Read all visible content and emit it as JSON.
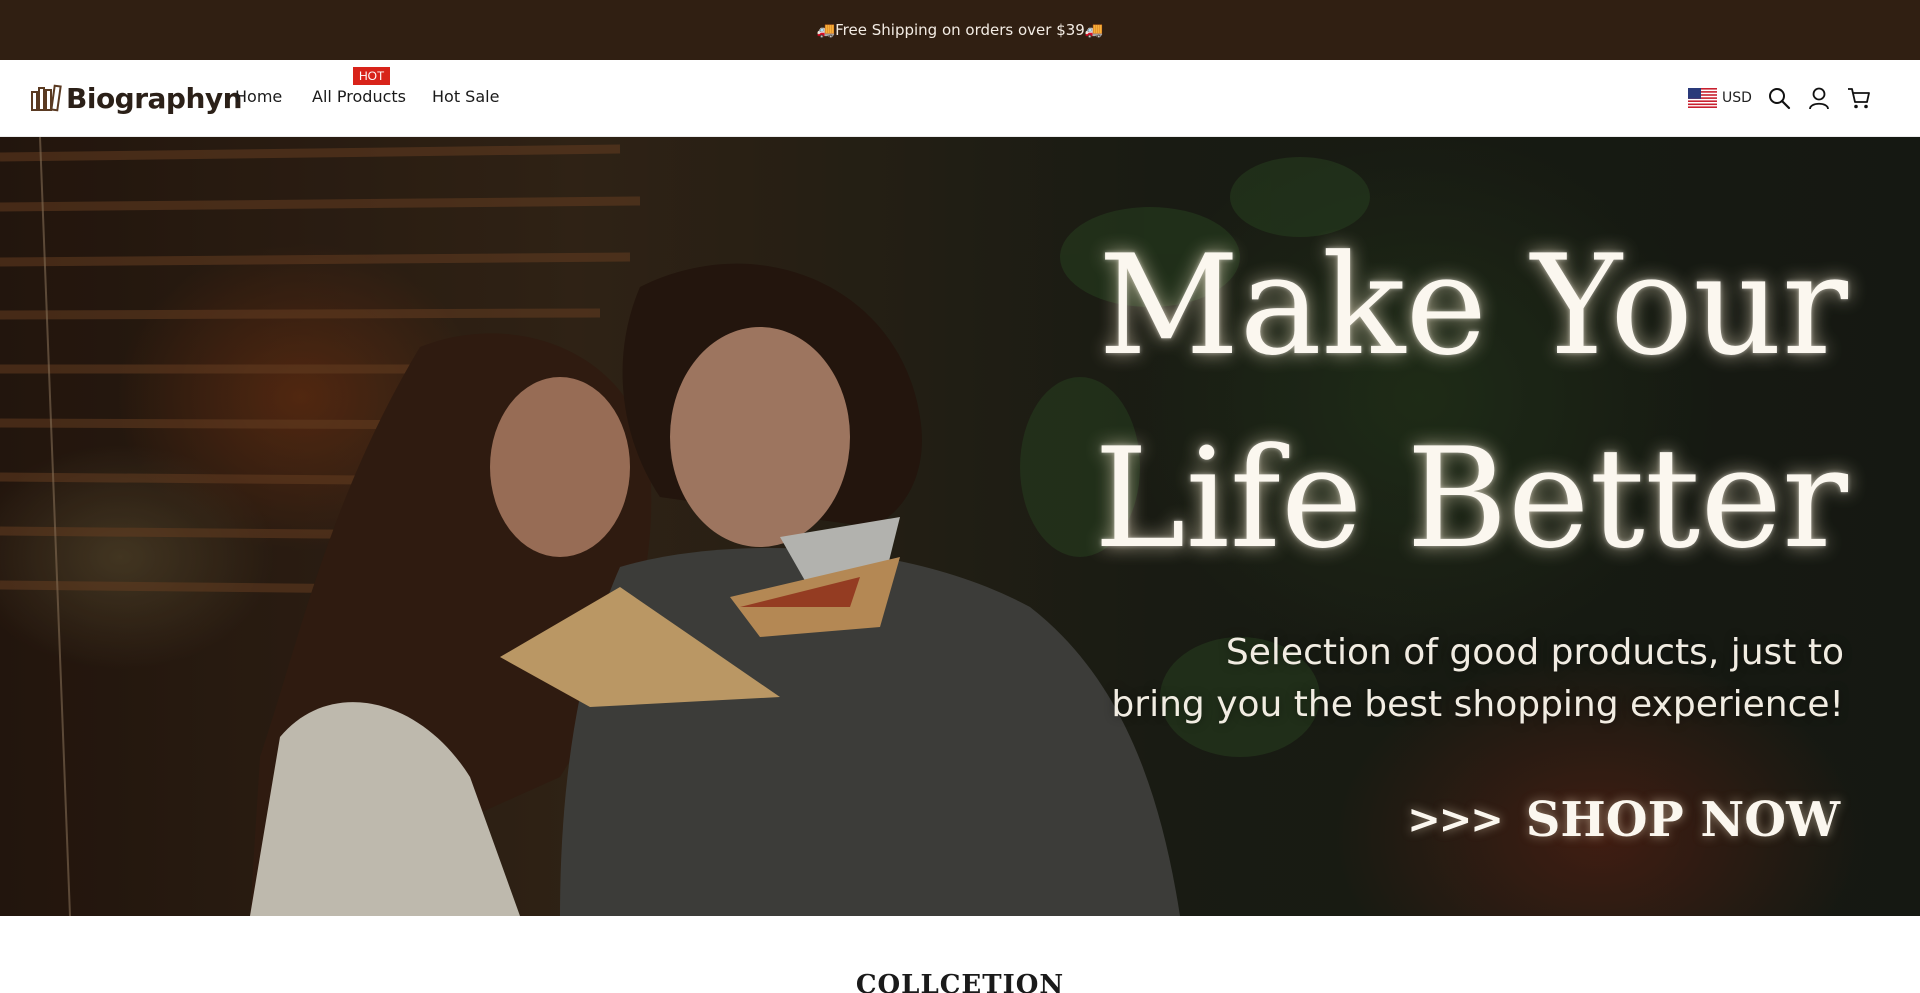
{
  "announcement": {
    "text": "🚚Free Shipping on orders over $39🚚"
  },
  "header": {
    "logo_text": "Biographyn",
    "nav": [
      {
        "label": "Home"
      },
      {
        "label": "All Products",
        "badge": "HOT"
      },
      {
        "label": "Hot Sale"
      }
    ],
    "currency": {
      "code": "USD",
      "flag_icon": "us-flag-icon"
    },
    "icons": [
      "search-icon",
      "account-icon",
      "cart-icon"
    ]
  },
  "hero": {
    "title_line1": "Make Your",
    "title_line2": "Life Better",
    "subtitle_line1": "Selection of good products, just to",
    "subtitle_line2": "bring you the best shopping experience!",
    "cta_arrows": ">>>",
    "cta_label": "SHOP NOW"
  },
  "section": {
    "heading": "COLLCETION"
  },
  "colors": {
    "announcement_bg": "#301f12",
    "badge_red": "#d8231a",
    "logo_brown": "#2b2018"
  }
}
